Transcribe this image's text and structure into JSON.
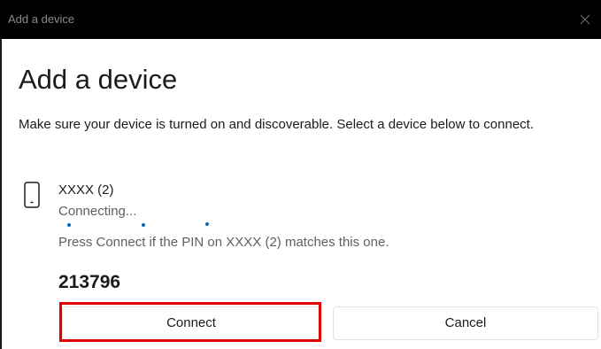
{
  "window": {
    "title": "Add a device",
    "close_icon": "close-icon"
  },
  "main": {
    "heading": "Add a device",
    "description": "Make sure your device is turned on and discoverable. Select a device below to connect."
  },
  "device": {
    "icon": "phone-icon",
    "name": "XXXX (2)",
    "status": "Connecting...",
    "pin_message": "Press Connect if the PIN on XXXX (2) matches this one.",
    "pin": "213796"
  },
  "actions": {
    "connect_label": "Connect",
    "cancel_label": "Cancel"
  },
  "colors": {
    "titlebar": "#000000",
    "accent": "#0067c0",
    "highlight": "#e00000"
  }
}
